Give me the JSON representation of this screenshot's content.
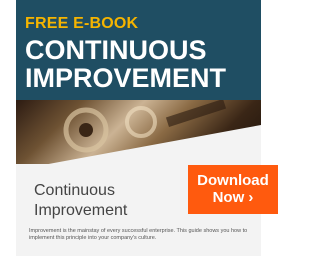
{
  "ad": {
    "eyebrow": "FREE E-BOOK",
    "title_line1": "CONTINUOUS",
    "title_line2": "IMPROVEMENT",
    "heading_line1": "Continuous",
    "heading_line2": "Improvement",
    "description": "Improvement is the mainstay of every successful enterprise. This guide shows you how to implement this principle into your company's culture.",
    "cta_line1": "Download",
    "cta_line2": "Now ›",
    "colors": {
      "hero": "#1f4e63",
      "accent": "#f5b400",
      "cta": "#ff5a0e"
    }
  }
}
